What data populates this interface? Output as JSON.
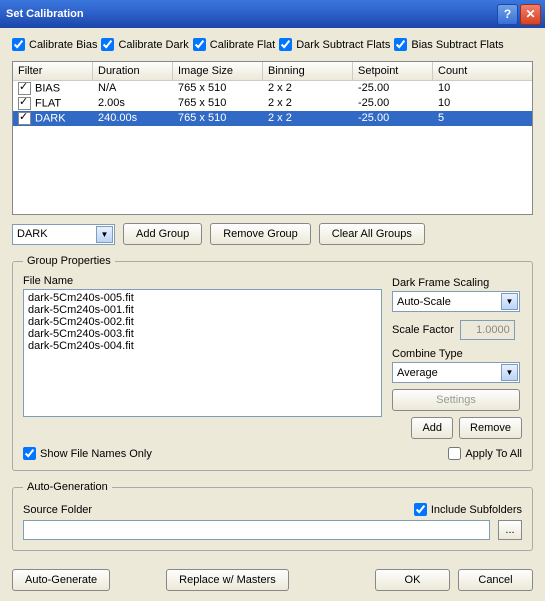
{
  "title": "Set Calibration",
  "top_checks": {
    "bias": "Calibrate Bias",
    "dark": "Calibrate Dark",
    "flat": "Calibrate Flat",
    "dsf": "Dark Subtract Flats",
    "bsf": "Bias Subtract Flats"
  },
  "table": {
    "headers": [
      "Filter",
      "Duration",
      "Image Size",
      "Binning",
      "Setpoint",
      "Count"
    ],
    "rows": [
      {
        "filter": "BIAS",
        "duration": "N/A",
        "size": "765 x 510",
        "bin": "2 x 2",
        "setpoint": "-25.00",
        "count": "10"
      },
      {
        "filter": "FLAT",
        "duration": "2.00s",
        "size": "765 x 510",
        "bin": "2 x 2",
        "setpoint": "-25.00",
        "count": "10"
      },
      {
        "filter": "DARK",
        "duration": "240.00s",
        "size": "765 x 510",
        "bin": "2 x 2",
        "setpoint": "-25.00",
        "count": "5"
      }
    ]
  },
  "group_select": "DARK",
  "buttons": {
    "add_group": "Add Group",
    "remove_group": "Remove Group",
    "clear_groups": "Clear All Groups",
    "settings": "Settings",
    "add": "Add",
    "remove": "Remove",
    "auto_generate": "Auto-Generate",
    "replace": "Replace w/ Masters",
    "ok": "OK",
    "cancel": "Cancel",
    "browse": "..."
  },
  "group_props": {
    "legend": "Group Properties",
    "file_name_label": "File Name",
    "files": [
      "dark-5Cm240s-005.fit",
      "dark-5Cm240s-001.fit",
      "dark-5Cm240s-002.fit",
      "dark-5Cm240s-003.fit",
      "dark-5Cm240s-004.fit"
    ],
    "dark_scaling": "Dark Frame Scaling",
    "scaling_value": "Auto-Scale",
    "scale_factor_label": "Scale Factor",
    "scale_factor": "1.0000",
    "combine_label": "Combine Type",
    "combine_value": "Average",
    "show_names": "Show File Names Only",
    "apply_all": "Apply To All"
  },
  "autogen": {
    "legend": "Auto-Generation",
    "source_folder": "Source Folder",
    "include_sub": "Include Subfolders"
  }
}
